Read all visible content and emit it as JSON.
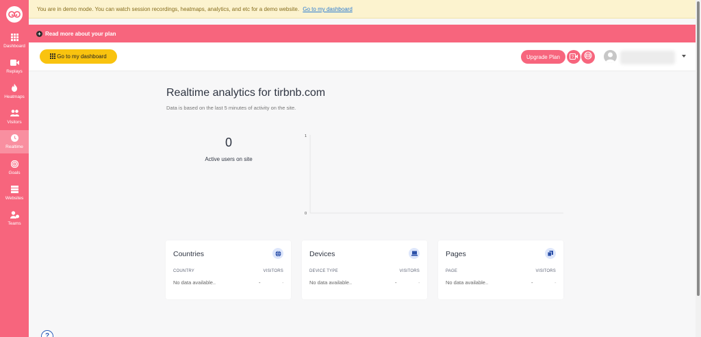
{
  "sidebar": {
    "items": [
      {
        "label": "Dashboard",
        "icon": "grid-icon"
      },
      {
        "label": "Replays",
        "icon": "video-icon"
      },
      {
        "label": "Heatmaps",
        "icon": "flame-icon"
      },
      {
        "label": "Visitors",
        "icon": "users-icon"
      },
      {
        "label": "Realtime",
        "icon": "clock-icon",
        "active": true
      },
      {
        "label": "Goals",
        "icon": "target-icon"
      },
      {
        "label": "Websites",
        "icon": "server-icon"
      },
      {
        "label": "Teams",
        "icon": "team-icon"
      }
    ]
  },
  "demo_banner": {
    "text": "You are in demo mode. You can watch session recordings, heatmaps, analytics, and etc for a demo website.",
    "link": "Go to my dashboard"
  },
  "plan_bar": {
    "text": "Read more about your plan"
  },
  "header": {
    "dashboard_button": "Go to my dashboard",
    "upgrade_button": "Upgrade Plan"
  },
  "main": {
    "title": "Realtime analytics for tirbnb.com",
    "subtitle": "Data is based on the last 5 minutes of activity on the site.",
    "active_users": "0",
    "active_users_label": "Active users on site"
  },
  "chart_data": {
    "type": "line",
    "series": [],
    "y_ticks": [
      "1",
      "0"
    ],
    "ylim": [
      0,
      1
    ],
    "grid": false
  },
  "cards": [
    {
      "title": "Countries",
      "icon": "globe-icon",
      "col_left": "COUNTRY",
      "col_right": "VISITORS",
      "empty": "No data available..",
      "dash_a": "-",
      "dash_b": "-"
    },
    {
      "title": "Devices",
      "icon": "laptop-icon",
      "col_left": "DEVICE TYPE",
      "col_right": "VISITORS",
      "empty": "No data available..",
      "dash_a": "-",
      "dash_b": "-"
    },
    {
      "title": "Pages",
      "icon": "copy-icon",
      "col_left": "PAGE",
      "col_right": "VISITORS",
      "empty": "No data available..",
      "dash_a": "-",
      "dash_b": "-"
    }
  ],
  "help": {
    "label": "?"
  },
  "colors": {
    "brand": "#f7657d",
    "accent": "#f9c30f",
    "banner": "#fcf3cf"
  }
}
